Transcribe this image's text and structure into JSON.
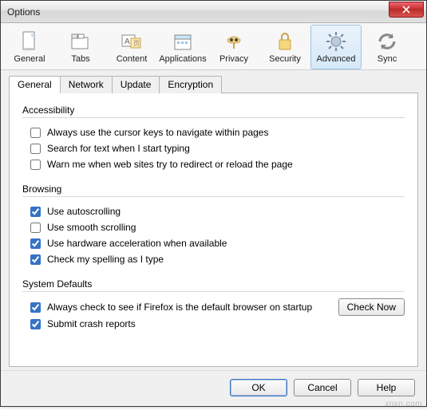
{
  "window": {
    "title": "Options"
  },
  "toolbar": {
    "items": [
      {
        "label": "General"
      },
      {
        "label": "Tabs"
      },
      {
        "label": "Content"
      },
      {
        "label": "Applications"
      },
      {
        "label": "Privacy"
      },
      {
        "label": "Security"
      },
      {
        "label": "Advanced"
      },
      {
        "label": "Sync"
      }
    ],
    "selected": "Advanced"
  },
  "subtabs": {
    "items": [
      "General",
      "Network",
      "Update",
      "Encryption"
    ],
    "selected": "General"
  },
  "groups": {
    "accessibility": {
      "title": "Accessibility",
      "items": [
        {
          "label": "Always use the cursor keys to navigate within pages",
          "checked": false
        },
        {
          "label": "Search for text when I start typing",
          "checked": false
        },
        {
          "label": "Warn me when web sites try to redirect or reload the page",
          "checked": false
        }
      ]
    },
    "browsing": {
      "title": "Browsing",
      "items": [
        {
          "label": "Use autoscrolling",
          "checked": true
        },
        {
          "label": "Use smooth scrolling",
          "checked": false
        },
        {
          "label": "Use hardware acceleration when available",
          "checked": true
        },
        {
          "label": "Check my spelling as I type",
          "checked": true
        }
      ]
    },
    "defaults": {
      "title": "System Defaults",
      "items": [
        {
          "label": "Always check to see if Firefox is the default browser on startup",
          "checked": true
        },
        {
          "label": "Submit crash reports",
          "checked": true
        }
      ],
      "check_now": "Check Now"
    }
  },
  "footer": {
    "ok": "OK",
    "cancel": "Cancel",
    "help": "Help"
  },
  "watermark": "xnxn.com"
}
